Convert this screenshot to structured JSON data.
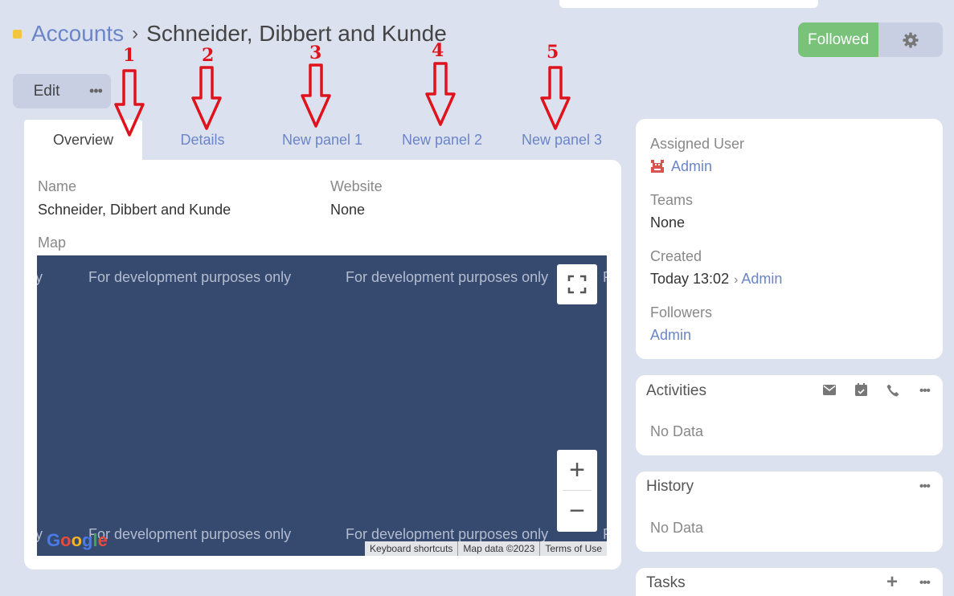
{
  "breadcrumb": {
    "parent": "Accounts",
    "separator": "›",
    "title": "Schneider, Dibbert and Kunde"
  },
  "header_buttons": {
    "followed": "Followed",
    "gear": "gear-icon"
  },
  "actions": {
    "edit": "Edit",
    "more": "•••"
  },
  "tabs": [
    {
      "label": "Overview",
      "active": true
    },
    {
      "label": "Details",
      "active": false
    },
    {
      "label": "New panel 1",
      "active": false
    },
    {
      "label": "New panel 2",
      "active": false
    },
    {
      "label": "New panel 3",
      "active": false
    }
  ],
  "annotations": [
    "1",
    "2",
    "3",
    "4",
    "5"
  ],
  "overview": {
    "name_label": "Name",
    "name_value": "Schneider, Dibbert and Kunde",
    "website_label": "Website",
    "website_value": "None",
    "map_label": "Map"
  },
  "map": {
    "watermark": "For development purposes only",
    "watermark_fragment_left": "y",
    "watermark_fragment_right": "F",
    "zoom_in": "+",
    "zoom_out": "−",
    "attribution": [
      "Keyboard shortcuts",
      "Map data ©2023",
      "Terms of Use"
    ],
    "logo": [
      "G",
      "o",
      "o",
      "g",
      "l",
      "e"
    ]
  },
  "side": {
    "assigned_user_label": "Assigned User",
    "assigned_user": "Admin",
    "teams_label": "Teams",
    "teams_value": "None",
    "created_label": "Created",
    "created_value": "Today 13:02",
    "created_sep": "›",
    "created_by": "Admin",
    "followers_label": "Followers",
    "followers_value": "Admin"
  },
  "activities": {
    "title": "Activities",
    "empty": "No Data",
    "icons": [
      "email-icon",
      "calendar-icon",
      "phone-icon",
      "more-icon"
    ]
  },
  "history": {
    "title": "History",
    "empty": "No Data"
  },
  "tasks": {
    "title": "Tasks",
    "add": "+"
  },
  "colors": {
    "accent_link": "#6b85c9",
    "followed_green": "#78c27a",
    "annotation_red": "#e0131d",
    "map_bg": "#364a6f"
  }
}
